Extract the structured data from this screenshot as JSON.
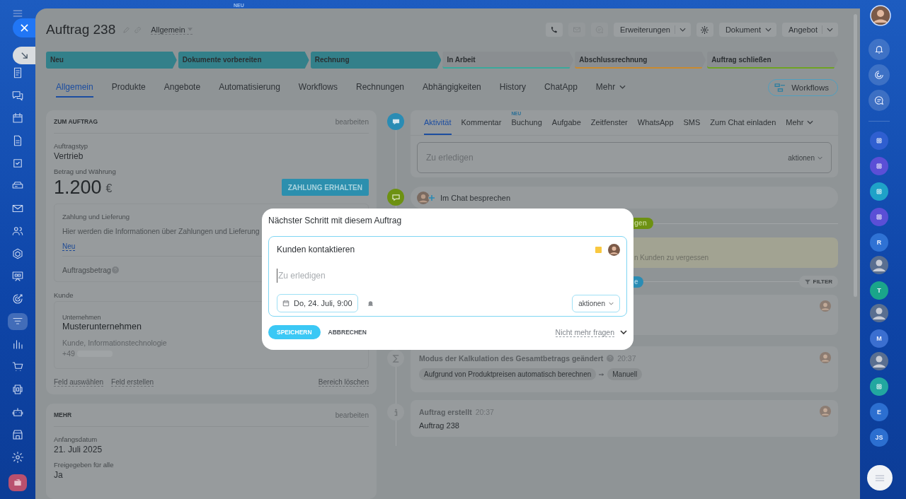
{
  "top_badge": "NEU",
  "left_nav": [
    {
      "selected": false
    },
    {
      "selected": false
    },
    {
      "selected": false
    },
    {
      "selected": false
    },
    {
      "selected": false
    },
    {
      "selected": false
    },
    {
      "selected": false
    },
    {
      "selected": false
    },
    {
      "selected": false
    },
    {
      "selected": false
    },
    {
      "selected": false
    },
    {
      "selected": true
    },
    {
      "selected": false
    },
    {
      "selected": false
    },
    {
      "selected": false
    },
    {
      "selected": false
    },
    {
      "selected": false
    },
    {
      "selected": false
    },
    {
      "selected": false
    }
  ],
  "header": {
    "title": "Auftrag 238",
    "category": "Allgemein",
    "buttons": [
      {
        "label": "Erweiterungen",
        "split": true
      },
      {
        "label": "Dokument",
        "split": false
      },
      {
        "label": "Angebot",
        "split": true
      }
    ]
  },
  "stages": [
    {
      "label": "Neu",
      "reached": true,
      "color": "#33808a"
    },
    {
      "label": "Dokumente vorbereiten",
      "reached": true,
      "color": "#33808a"
    },
    {
      "label": "Rechnung",
      "reached": true,
      "color": "#33808a"
    },
    {
      "label": "In Arbeit",
      "reached": false,
      "color": "#3aa99b"
    },
    {
      "label": "Abschlussrechnung",
      "reached": false,
      "color": "#c98a2e"
    },
    {
      "label": "Auftrag schließen",
      "reached": false,
      "color": "#6fa322"
    }
  ],
  "tabs": [
    {
      "label": "Allgemein",
      "selected": true,
      "kind": "tab"
    },
    {
      "label": "Produkte",
      "selected": false,
      "kind": "tab"
    },
    {
      "label": "Angebote",
      "selected": false,
      "kind": "tab"
    },
    {
      "label": "Automatisierung",
      "selected": false,
      "kind": "tab"
    },
    {
      "label": "Workflows",
      "selected": false,
      "kind": "tab"
    },
    {
      "label": "Rechnungen",
      "selected": false,
      "kind": "tab"
    },
    {
      "label": "Abhängigkeiten",
      "selected": false,
      "kind": "tab"
    },
    {
      "label": "History",
      "selected": false,
      "kind": "tab"
    },
    {
      "label": "ChatApp",
      "selected": false,
      "kind": "tab"
    },
    {
      "label": "Mehr",
      "selected": false,
      "kind": "menu"
    }
  ],
  "workflows_button": "Workflows",
  "order_card": {
    "title": "ZUM AUFTRAG",
    "edit_link": "bearbeiten",
    "type_label": "Auftragstyp",
    "type_value": "Vertrieb",
    "amount_label": "Betrag und Währung",
    "amount": "1.200",
    "currency": "€",
    "pay_button": "ZAHLUNG ERHALTEN",
    "payment": {
      "title": "Zahlung und Lieferung",
      "text": "Hier werden die Informationen über Zahlungen und Lieferung",
      "new_link": "Neu",
      "total_label": "Auftragsbetrag"
    },
    "client_label": "Kunde",
    "client": {
      "type": "Unternehmen",
      "name": "Musterunternehmen",
      "details": "Kunde, Informationstechnologie",
      "phone": "+49"
    },
    "links": [
      "Feld auswählen",
      "Feld erstellen"
    ],
    "delete_link": "Bereich löschen"
  },
  "more_card": {
    "title": "MEHR",
    "edit_link": "bearbeiten",
    "fields": [
      {
        "label": "Anfangsdatum",
        "value": "21. Juli 2025"
      },
      {
        "label": "Freigegeben für alle",
        "value": "Ja"
      }
    ]
  },
  "activity": {
    "tabs": [
      {
        "label": "Aktivität",
        "selected": true
      },
      {
        "label": "Kommentar",
        "selected": false
      },
      {
        "label": "Buchung",
        "selected": false,
        "badge": "NEU"
      },
      {
        "label": "Aufgabe",
        "selected": false
      },
      {
        "label": "Zeitfenster",
        "selected": false
      },
      {
        "label": "WhatsApp",
        "selected": false
      },
      {
        "label": "SMS",
        "selected": false
      },
      {
        "label": "Zum Chat einladen",
        "selected": false
      }
    ],
    "more": "Mehr",
    "placeholder": "Zu erledigen",
    "actions": "aktionen"
  },
  "chat_row": "Im Chat besprechen",
  "timeline": {
    "pending_pill": "gen",
    "note": "n Kunden zu vergessen",
    "history_pill": "e",
    "filter": "FILTER",
    "events": [
      {
        "kind": "change",
        "title": "Modus der Kalkulation des Gesamtbetrags geändert",
        "time": "20:37",
        "from": "Aufgrund von Produktpreisen automatisch berechnen",
        "to": "Manuell"
      },
      {
        "kind": "created",
        "title": "Auftrag erstellt",
        "time": "20:37",
        "text": "Auftrag 238"
      }
    ]
  },
  "modal": {
    "title": "Nächster Schritt mit diesem Auftrag",
    "task": "Kunden kontaktieren",
    "placeholder": "Zu erledigen",
    "date": "Do, 24. Juli, 9:00",
    "actions": "aktionen",
    "save": "SPEICHERN",
    "cancel": "ABBRECHEN",
    "dont_ask": "Nicht mehr fragen"
  },
  "right_rail": [
    {
      "kind": "app",
      "color": "#2f5fd0"
    },
    {
      "kind": "app",
      "color": "#5b4fd6"
    },
    {
      "kind": "app",
      "color": "#1fa2c8"
    },
    {
      "kind": "app",
      "color": "#5b4fd6"
    },
    {
      "kind": "letter",
      "text": "R",
      "color": "#2f72d4"
    },
    {
      "kind": "person"
    },
    {
      "kind": "letter",
      "text": "T",
      "color": "#1aa58a"
    },
    {
      "kind": "person"
    },
    {
      "kind": "letter",
      "text": "M",
      "color": "#3b6fd0"
    },
    {
      "kind": "person"
    },
    {
      "kind": "app",
      "color": "#22a7a0"
    },
    {
      "kind": "letter",
      "text": "E",
      "color": "#2c6fd0"
    },
    {
      "kind": "letter",
      "text": "JS",
      "color": "#2c6fd0"
    }
  ]
}
